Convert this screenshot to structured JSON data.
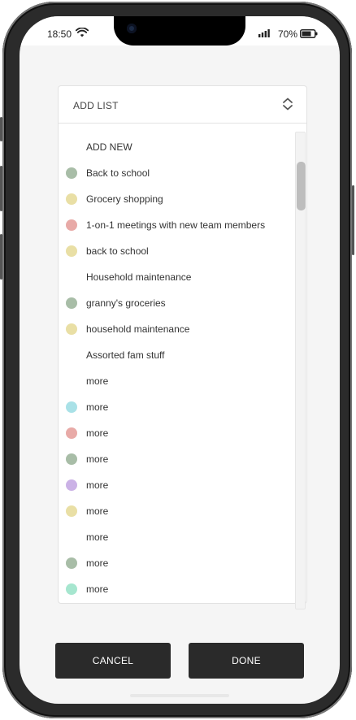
{
  "status_bar": {
    "time": "18:50",
    "battery_percent": "70%",
    "icons": [
      "wifi-icon",
      "signal-icon",
      "battery-icon"
    ]
  },
  "picker": {
    "title": "ADD LIST",
    "items": [
      {
        "label": "ADD NEW",
        "color": null
      },
      {
        "label": "Back to school",
        "color": "#a8bda7"
      },
      {
        "label": "Grocery shopping",
        "color": "#e9dfa5"
      },
      {
        "label": "1-on-1 meetings with new team members",
        "color": "#e8aaa7"
      },
      {
        "label": "back to school",
        "color": "#e9dfa5"
      },
      {
        "label": "Household maintenance",
        "color": null
      },
      {
        "label": "granny's groceries",
        "color": "#a8bda7"
      },
      {
        "label": "household maintenance",
        "color": "#e9dfa5"
      },
      {
        "label": "Assorted fam stuff",
        "color": null
      },
      {
        "label": "more",
        "color": null
      },
      {
        "label": "more",
        "color": "#a9e1e7"
      },
      {
        "label": "more",
        "color": "#e8aaa7"
      },
      {
        "label": "more",
        "color": "#a8bda7"
      },
      {
        "label": "more",
        "color": "#cbb2e6"
      },
      {
        "label": "more",
        "color": "#e9dfa5"
      },
      {
        "label": "more",
        "color": null
      },
      {
        "label": "more",
        "color": "#a8bda7"
      },
      {
        "label": "more",
        "color": "#a6e6cf"
      }
    ]
  },
  "actions": {
    "cancel_label": "CANCEL",
    "done_label": "DONE"
  },
  "colors": {
    "button_bg": "#2a2a2a",
    "screen_bg": "#f5f5f5"
  }
}
